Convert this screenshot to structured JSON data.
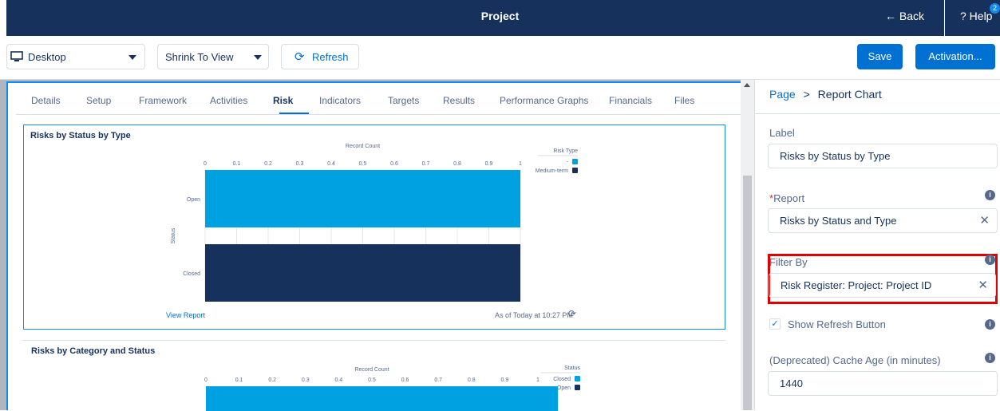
{
  "topbar": {
    "title": "Project",
    "back_label": "← Back",
    "help_label": "? Help",
    "help_badge": "2"
  },
  "toolbar": {
    "device_select": "Desktop",
    "view_select": "Shrink To View",
    "refresh_label": "Refresh",
    "save_label": "Save",
    "activation_label": "Activation..."
  },
  "tabs": [
    "Details",
    "Setup",
    "Framework",
    "Activities",
    "Risk",
    "Indicators",
    "Targets",
    "Results",
    "Performance Graphs",
    "Financials",
    "Files"
  ],
  "active_tab": "Risk",
  "charts": {
    "chart1": {
      "title": "Risks by Status by Type",
      "view_report": "View Report",
      "as_of": "As of Today at 10:27 PM"
    },
    "chart2": {
      "title": "Risks by Category and Status"
    }
  },
  "chart_data": [
    {
      "type": "bar",
      "orientation": "horizontal-stacked",
      "title": "Risks by Status by Type",
      "xlabel": "Record Count",
      "ylabel": "Status",
      "xlim": [
        0,
        1
      ],
      "xticks": [
        "0",
        "0.1",
        "0.2",
        "0.3",
        "0.4",
        "0.5",
        "0.6",
        "0.7",
        "0.8",
        "0.9",
        "1"
      ],
      "categories": [
        "Open",
        "Closed"
      ],
      "legend_title": "Risk Type",
      "legend_placement": "top-right",
      "series": [
        {
          "name": "-",
          "color": "#00a1e0",
          "values": [
            1,
            0
          ]
        },
        {
          "name": "Medium-term",
          "color": "#16325c",
          "values": [
            0,
            1
          ]
        }
      ]
    },
    {
      "type": "bar",
      "orientation": "horizontal-stacked",
      "title": "Risks by Category and Status",
      "xlabel": "Record Count",
      "xlim": [
        0,
        1
      ],
      "xticks": [
        "0",
        "0.1",
        "0.2",
        "0.3",
        "0.4",
        "0.5",
        "0.6",
        "0.7",
        "0.8",
        "0.9",
        "1"
      ],
      "legend_title": "Status",
      "legend_placement": "top-right",
      "series": [
        {
          "name": "Closed",
          "color": "#00a1e0"
        },
        {
          "name": "Open",
          "color": "#16325c"
        }
      ]
    }
  ],
  "panel": {
    "crumb_page": "Page",
    "crumb_sep": ">",
    "crumb_current": "Report Chart",
    "label_title": "Label",
    "label_value": "Risks by Status by Type",
    "report_req": "*",
    "report_title": "Report",
    "report_value": "Risks by Status and Type",
    "filter_title": "Filter By",
    "filter_value": "Risk Register: Project: Project ID",
    "show_refresh_label": "Show Refresh Button",
    "cache_title": "(Deprecated) Cache Age (in minutes)",
    "cache_value": "1440"
  },
  "colors": {
    "brand_dark": "#16325c",
    "accent": "#0070d2",
    "highlight": "#e00000"
  }
}
